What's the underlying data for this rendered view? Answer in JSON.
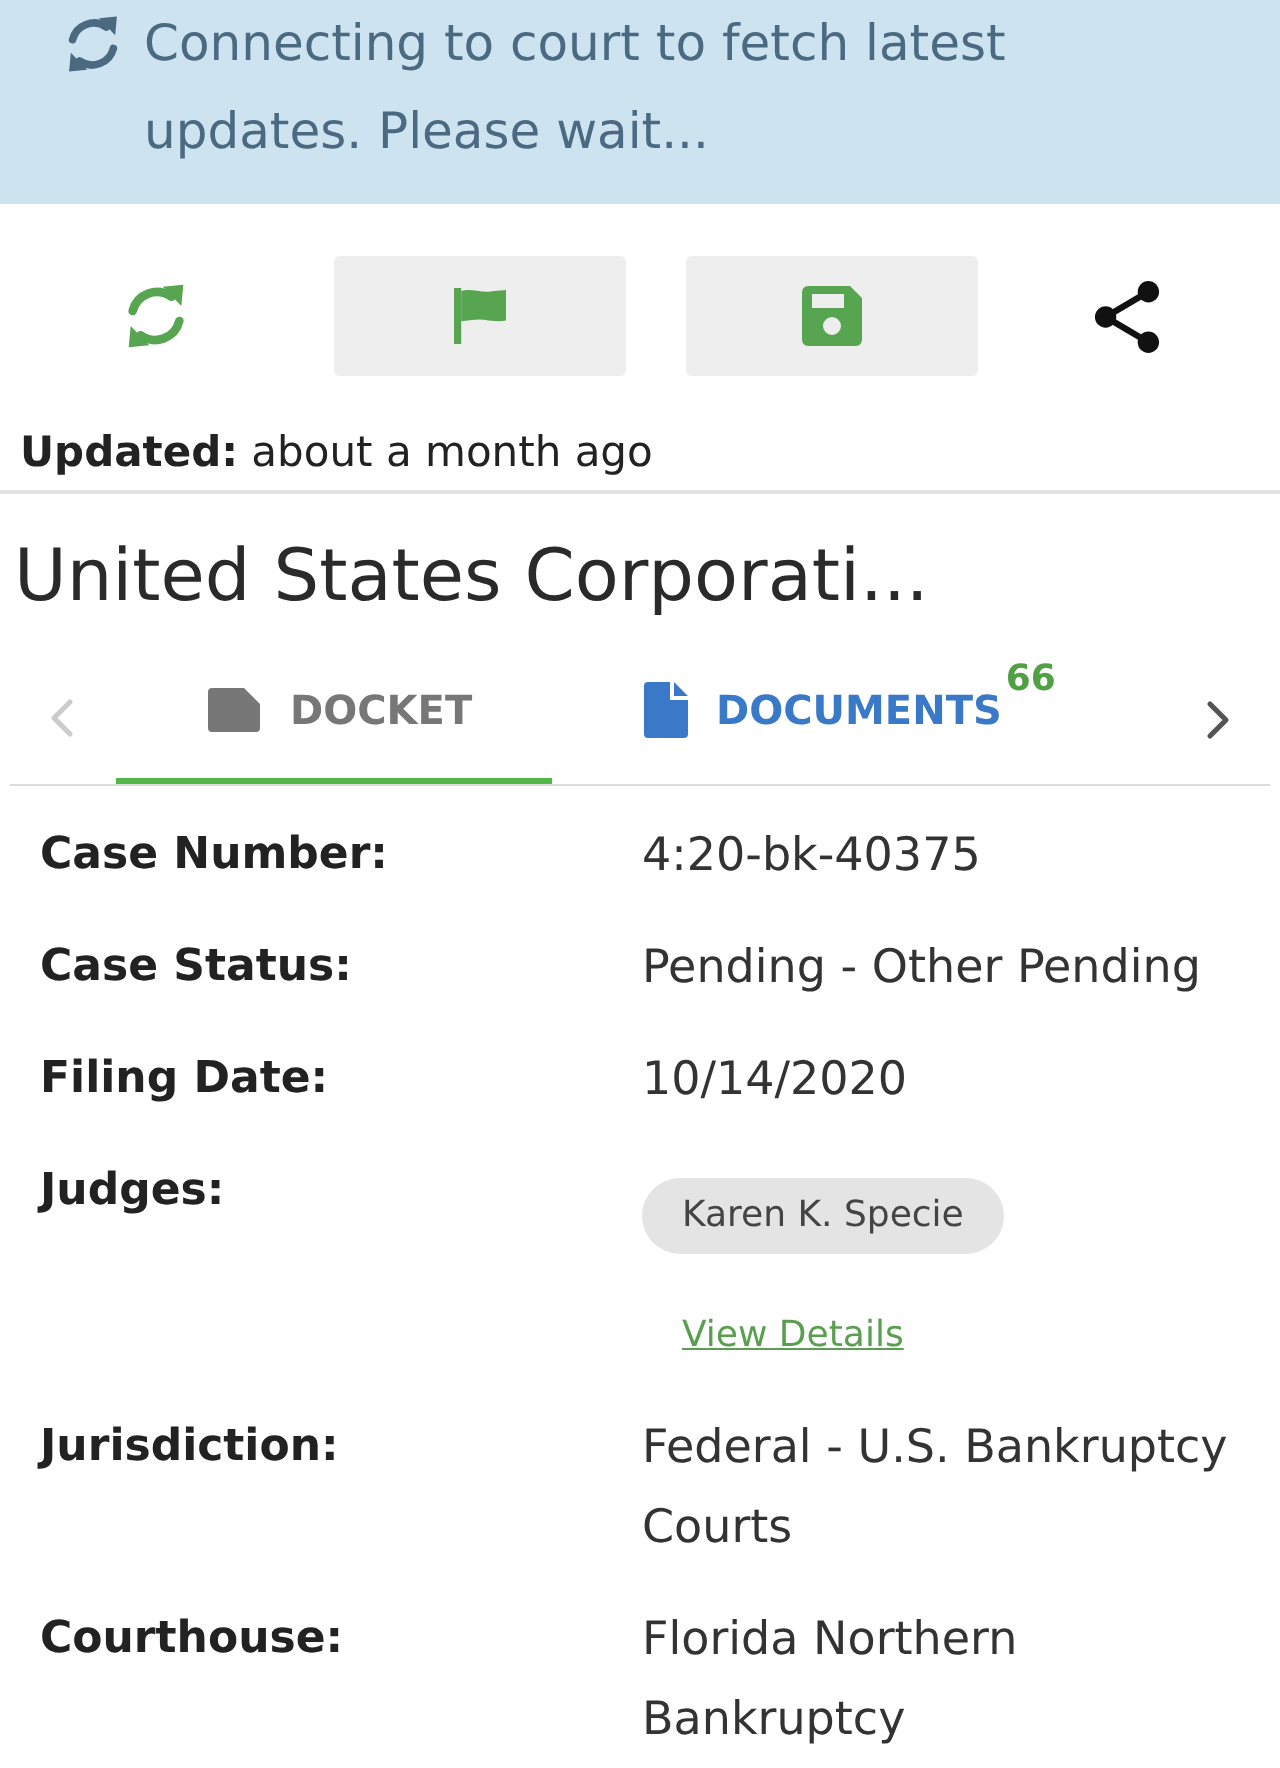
{
  "banner": {
    "message": "Connecting to court to fetch latest updates. Please wait..."
  },
  "updated": "**Updated:** about a month ago",
  "title": "United States Corporati...",
  "tab_arrows": [
    {
      "kind": "previous",
      "disabled": true
    },
    {
      "kind": "next",
      "disabled": false
    }
  ],
  "tabs": [
    {
      "label": "DOCKET",
      "selected": true
    },
    {
      "label": "DOCUMENTS",
      "selected": false,
      "badge": "66"
    }
  ],
  "details": [
    {
      "kind": "text",
      "label": "Case Number:",
      "value": "4:20-bk-40375"
    },
    {
      "kind": "text",
      "label": "Case Status:",
      "value": "Pending - Other Pending"
    },
    {
      "kind": "text",
      "label": "Filing Date:",
      "value": "10/14/2020"
    },
    {
      "kind": "chips",
      "label": "Judges:",
      "chips": [
        "Karen K. Specie"
      ],
      "link": "View Details"
    },
    {
      "kind": "text",
      "label": "Jurisdiction:",
      "value": "Federal - U.S. Bankruptcy Courts"
    },
    {
      "kind": "text",
      "label": "Courthouse:",
      "value": "Florida Northern Bankruptcy"
    }
  ]
}
